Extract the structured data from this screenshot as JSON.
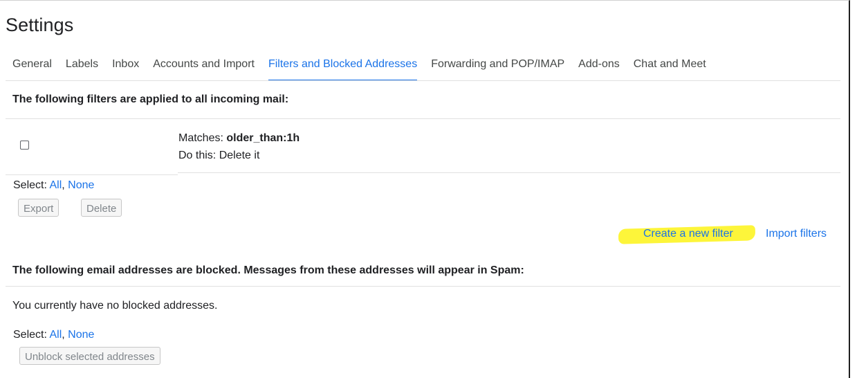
{
  "page": {
    "title": "Settings"
  },
  "tabs": [
    {
      "label": "General",
      "active": false
    },
    {
      "label": "Labels",
      "active": false
    },
    {
      "label": "Inbox",
      "active": false
    },
    {
      "label": "Accounts and Import",
      "active": false
    },
    {
      "label": "Filters and Blocked Addresses",
      "active": true
    },
    {
      "label": "Forwarding and POP/IMAP",
      "active": false
    },
    {
      "label": "Add-ons",
      "active": false
    },
    {
      "label": "Chat and Meet",
      "active": false
    }
  ],
  "filters": {
    "heading": "The following filters are applied to all incoming mail:",
    "items": [
      {
        "checked": false,
        "matches_label": "Matches: ",
        "matches_value": "older_than:1h",
        "action": "Do this: Delete it"
      }
    ],
    "select_label": "Select: ",
    "select_all": "All",
    "select_sep": ", ",
    "select_none": "None",
    "export_label": "Export",
    "delete_label": "Delete",
    "create_filter_label": "Create a new filter",
    "import_filters_label": "Import filters"
  },
  "blocked": {
    "heading": "The following email addresses are blocked. Messages from these addresses will appear in Spam:",
    "empty_text": "You currently have no blocked addresses.",
    "select_label": "Select: ",
    "select_all": "All",
    "select_sep": ", ",
    "select_none": "None",
    "unblock_label": "Unblock selected addresses"
  },
  "colors": {
    "accent": "#1a73e8",
    "highlight": "#fdf53a",
    "text": "#202124"
  }
}
